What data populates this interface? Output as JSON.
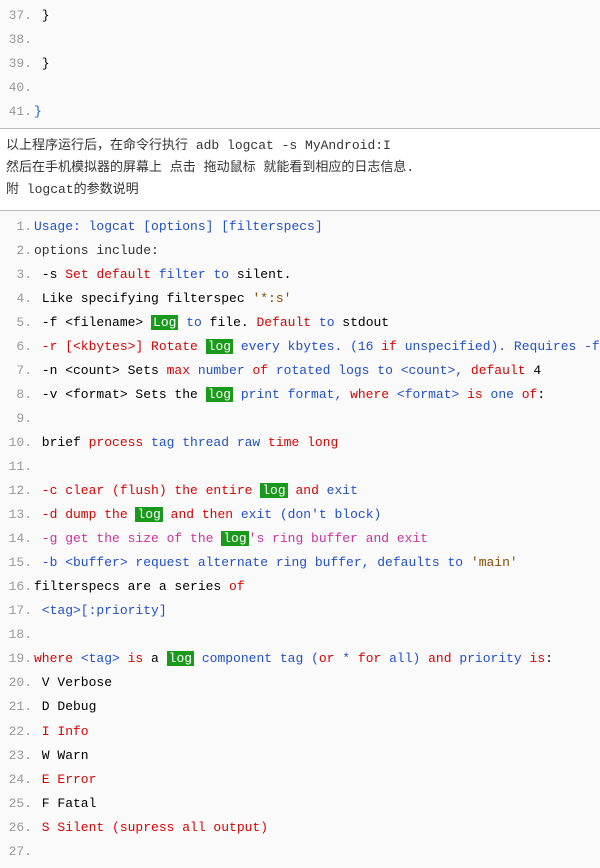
{
  "top": {
    "l37": {
      "num": "37.",
      "txt": " }"
    },
    "l38": {
      "num": "38.",
      "txt": ""
    },
    "l39": {
      "num": "39.",
      "txt": " }"
    },
    "l40": {
      "num": "40.",
      "txt": ""
    },
    "l41": {
      "num": "41.",
      "txt": "}"
    }
  },
  "intro": {
    "line1_a": "以上程序运行后，在命令行执行  ",
    "line1_cmd": "adb logcat -s MyAndroid:I",
    "line2": "然后在手机模拟器的屏幕上 点击 拖动鼠标 就能看到相应的日志信息.",
    "line3": "附 logcat的参数说明"
  },
  "doc": {
    "n": [
      "1.",
      "2.",
      "3.",
      "4.",
      "5.",
      "6.",
      "7.",
      "8.",
      "9.",
      "10.",
      "11.",
      "12.",
      "13.",
      "14.",
      "15.",
      "16.",
      "17.",
      "18.",
      "19.",
      "20.",
      "21.",
      "22.",
      "23.",
      "24.",
      "25.",
      "26.",
      "27."
    ],
    "l1": {
      "a": "Usage: logcat [options] [filterspecs]"
    },
    "l2": {
      "a": "options include:"
    },
    "l3": {
      "a": " -s ",
      "b": "Set",
      "c": " ",
      "d": "default",
      "e": " filter ",
      "f": "to",
      "g": " silent."
    },
    "l4": {
      "a": " Like specifying filterspec ",
      "b": "'*:s'"
    },
    "l5": {
      "a": " -f <filename> ",
      "b": "Log",
      "c": " ",
      "d": "to",
      "e": " file. ",
      "f": "Default",
      "g": " ",
      "h": "to",
      "i": " stdout"
    },
    "l6": {
      "a": " -r [<kbytes>] Rotate ",
      "b": "log",
      "c": " every kbytes. (16 ",
      "d": "if",
      "e": " unspecified). Requires -f"
    },
    "l7": {
      "a": " -n <count> Sets ",
      "b": "max",
      "c": " number ",
      "d": "of",
      "e": " rotated logs ",
      "f": "to",
      "g": " <count>, ",
      "h": "default",
      "i": " 4"
    },
    "l8": {
      "a": " -v <format> Sets the ",
      "b": "log",
      "c": " print format, ",
      "d": "where",
      "e": " <format> ",
      "f": "is",
      "g": " one ",
      "h": "of",
      "i": ":"
    },
    "l10": {
      "a": " brief ",
      "b": "process",
      "c": " tag thread raw ",
      "d": "time",
      "e": " ",
      "f": "long"
    },
    "l12": {
      "a": " -c clear (flush) the entire ",
      "b": "log",
      "c": " ",
      "d": "and",
      "e": " exit"
    },
    "l13": {
      "a": " -d dump the ",
      "b": "log",
      "c": " ",
      "d": "and",
      "e": " ",
      "f": "then",
      "g": " exit (don't block)"
    },
    "l14": {
      "a": " -g get the size of the ",
      "b": "log",
      "c": "'s ring buffer and exit"
    },
    "l15": {
      "a": " -b <buffer> request alternate ring buffer, defaults ",
      "b": "to",
      "c": " ",
      "d": "'main'"
    },
    "l16": {
      "a": "filterspecs are a series ",
      "b": "of"
    },
    "l17": {
      "a": " <tag>[:priority]"
    },
    "l19": {
      "a": "where",
      "b": " <tag> ",
      "c": "is",
      "d": " a ",
      "e": "log",
      "f": " component tag (",
      "g": "or",
      "h": " * ",
      "i": "for",
      "j": " all) ",
      "k": "and",
      "l": " priority ",
      "m": "is",
      "n": ":"
    },
    "l20": {
      "a": " V Verbose"
    },
    "l21": {
      "a": " D Debug"
    },
    "l22": {
      "a": " I Info"
    },
    "l23": {
      "a": " W Warn"
    },
    "l24": {
      "a": " E Error"
    },
    "l25": {
      "a": " F Fatal"
    },
    "l26": {
      "a": " S Silent (supress all output)"
    }
  }
}
